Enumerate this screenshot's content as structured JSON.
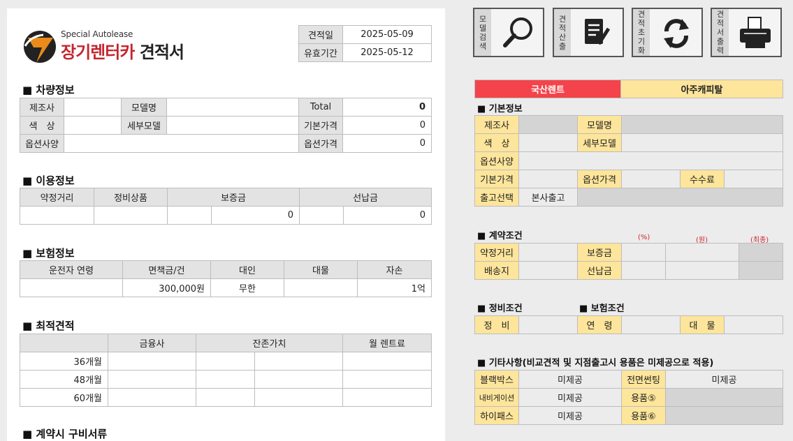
{
  "logo": {
    "subtitle": "Special Autolease",
    "title_red": "장기렌터카",
    "title_black": " 견적서"
  },
  "dates": [
    {
      "label": "견적일",
      "value": "2025-05-09"
    },
    {
      "label": "유효기간",
      "value": "2025-05-12"
    }
  ],
  "vehicle": {
    "title": "■ 차량정보",
    "manufacturer": "제조사",
    "model": "모델명",
    "color": "색　상",
    "submodel": "세부모델",
    "options": "옵션사양",
    "total_label": "Total",
    "total_value": "0",
    "base_label": "기본가격",
    "base_value": "0",
    "option_price_label": "옵션가격",
    "option_price_value": "0"
  },
  "usage": {
    "title": "■ 이용정보",
    "headers": [
      "약정거리",
      "정비상품",
      "보증금",
      "선납금"
    ],
    "deposit_value": "0",
    "prepay_value": "0"
  },
  "insurance": {
    "title": "■ 보험정보",
    "headers": [
      "운전자 연령",
      "면책금/건",
      "대인",
      "대물",
      "자손"
    ],
    "values": [
      "",
      "300,000원",
      "무한",
      "",
      "1억"
    ]
  },
  "best": {
    "title": "■ 최적견적",
    "headers": [
      "",
      "금융사",
      "잔존가치",
      "월 렌트료"
    ],
    "rows": [
      "36개월",
      "48개월",
      "60개월"
    ]
  },
  "docs": {
    "title": "■ 계약시 구비서류"
  },
  "buttons": [
    {
      "label": "모델검색",
      "icon": "search-icon"
    },
    {
      "label": "견적산출",
      "icon": "document-edit-icon"
    },
    {
      "label": "견적초기화",
      "icon": "refresh-icon"
    },
    {
      "label": "견적서출력",
      "icon": "printer-icon"
    }
  ],
  "tabs": [
    {
      "label": "국산렌트",
      "color": "#f4434b"
    },
    {
      "label": "아주캐피탈",
      "color": "#fde59b"
    }
  ],
  "basic": {
    "title": "■ 기본정보",
    "manufacturer": "제조사",
    "model": "모델명",
    "color": "색　상",
    "submodel": "세부모델",
    "options": "옵션사양",
    "base_price": "기본가격",
    "option_price": "옵션가격",
    "fee": "수수료",
    "delivery": "출고선택",
    "delivery_value": "본사출고"
  },
  "contract": {
    "title": "■ 계약조건",
    "pct": "(%)",
    "won": "(원)",
    "final": "(최종)",
    "distance": "약정거리",
    "deposit": "보증금",
    "shipping": "배송지",
    "prepay": "선납금"
  },
  "maint": {
    "title": "■ 정비조건",
    "ins_title": "■ 보험조건",
    "maint": "정　비",
    "age": "연　령",
    "property": "대　물"
  },
  "etc": {
    "title": "■ 기타사항(비교견적 및 지점출고시 용품은 미제공으로 적용)",
    "rows": [
      [
        "블랙박스",
        "미제공",
        "전면썬팅",
        "미제공"
      ],
      [
        "내비게이션",
        "미제공",
        "용품⑤",
        ""
      ],
      [
        "하이패스",
        "미제공",
        "용품⑥",
        ""
      ]
    ]
  }
}
